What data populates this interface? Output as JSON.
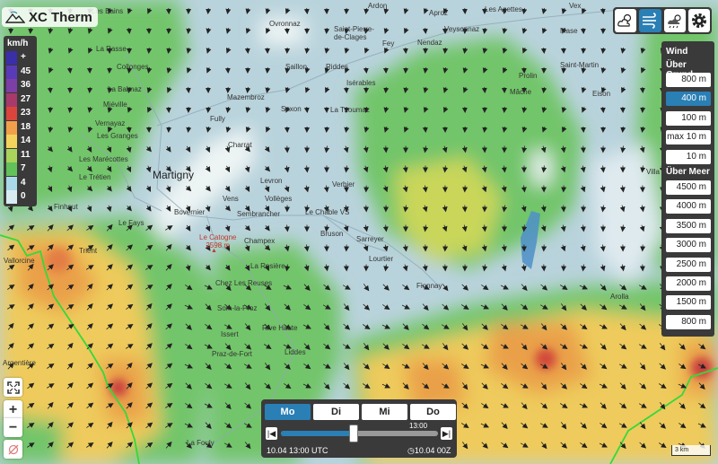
{
  "app": {
    "title": "XC Therm"
  },
  "legend": {
    "unit": "km/h",
    "rows": [
      {
        "label": "+",
        "color": "#3a2fa8"
      },
      {
        "label": "45",
        "color": "#5a3bb7"
      },
      {
        "label": "36",
        "color": "#7b3fa6"
      },
      {
        "label": "27",
        "color": "#a73a6b"
      },
      {
        "label": "23",
        "color": "#d9453c"
      },
      {
        "label": "18",
        "color": "#f0a04a"
      },
      {
        "label": "14",
        "color": "#f3d25e"
      },
      {
        "label": "11",
        "color": "#a9d35a"
      },
      {
        "label": "7",
        "color": "#63c15a"
      },
      {
        "label": "4",
        "color": "#a9d9e8"
      },
      {
        "label": "0",
        "color": "#d8ecf2"
      }
    ]
  },
  "top_buttons": [
    {
      "icon": "cloud-sun-icon",
      "active": false
    },
    {
      "icon": "wind-icon",
      "active": true
    },
    {
      "icon": "weather-overview-icon",
      "active": false
    },
    {
      "icon": "gear-icon",
      "active": false
    }
  ],
  "panel": {
    "title": "Wind",
    "section_ground": "Über Grund",
    "ground_levels": [
      "800 m",
      "400 m",
      "100 m",
      "max 10 m",
      "10 m"
    ],
    "ground_active": "400 m",
    "section_sea": "Über Meer",
    "sea_levels": [
      "4500 m",
      "4000 m",
      "3500 m",
      "3000 m",
      "2500 m",
      "2000 m",
      "1500 m",
      "800 m"
    ]
  },
  "timebar": {
    "days": [
      "Mo",
      "Di",
      "Mi",
      "Do"
    ],
    "active_day": "Mo",
    "start_label": "10.04 13:00 UTC",
    "end_label": "10.04 00Z",
    "tooltip": "13:00",
    "step_back": "|◀",
    "step_forward": "▶|",
    "progress": 0.46
  },
  "zoom": {
    "fullscreen_icon": "fullscreen-icon",
    "zoom_in": "+",
    "zoom_out": "−",
    "locate_icon": "location-off-icon"
  },
  "scale_label": "3 km",
  "map_labels": [
    {
      "text": "Les Bains",
      "cls": ""
    },
    {
      "text": "Ovronnaz",
      "cls": ""
    },
    {
      "text": "Ardon",
      "cls": ""
    },
    {
      "text": "Aproz",
      "cls": ""
    },
    {
      "text": "Les Agettes",
      "cls": ""
    },
    {
      "text": "Vex",
      "cls": ""
    },
    {
      "text": "Saint-Pierre-\nde-Clages",
      "cls": ""
    },
    {
      "text": "Veysonnaz",
      "cls": ""
    },
    {
      "text": "Mase",
      "cls": ""
    },
    {
      "text": "Fey",
      "cls": ""
    },
    {
      "text": "Nendaz",
      "cls": ""
    },
    {
      "text": "La Rasse",
      "cls": ""
    },
    {
      "text": "Collonges",
      "cls": ""
    },
    {
      "text": "Saillon",
      "cls": ""
    },
    {
      "text": "Riddes",
      "cls": ""
    },
    {
      "text": "Isérables",
      "cls": ""
    },
    {
      "text": "Prolin",
      "cls": ""
    },
    {
      "text": "Saint-Martin",
      "cls": ""
    },
    {
      "text": "La Balmaz",
      "cls": ""
    },
    {
      "text": "Mazembroz",
      "cls": ""
    },
    {
      "text": "Mâche",
      "cls": ""
    },
    {
      "text": "Eison",
      "cls": ""
    },
    {
      "text": "Miéville",
      "cls": ""
    },
    {
      "text": "Saxon",
      "cls": ""
    },
    {
      "text": "La Tzoumaz",
      "cls": ""
    },
    {
      "text": "Vernayaz",
      "cls": ""
    },
    {
      "text": "Fully",
      "cls": ""
    },
    {
      "text": "Les Granges",
      "cls": ""
    },
    {
      "text": "Charrat",
      "cls": ""
    },
    {
      "text": "Les Marécottes",
      "cls": ""
    },
    {
      "text": "Le Trétien",
      "cls": ""
    },
    {
      "text": "Martigny",
      "cls": "big"
    },
    {
      "text": "Levron",
      "cls": ""
    },
    {
      "text": "Verbier",
      "cls": ""
    },
    {
      "text": "Villa",
      "cls": ""
    },
    {
      "text": "Finhaut",
      "cls": ""
    },
    {
      "text": "Vens",
      "cls": ""
    },
    {
      "text": "Vollèges",
      "cls": ""
    },
    {
      "text": "Bovernier",
      "cls": ""
    },
    {
      "text": "Sembrancher",
      "cls": ""
    },
    {
      "text": "Le Châble VS",
      "cls": ""
    },
    {
      "text": "Le Fays",
      "cls": ""
    },
    {
      "text": "Le Catogne\n2598 m",
      "cls": "peak"
    },
    {
      "text": "Bruson",
      "cls": ""
    },
    {
      "text": "Trient",
      "cls": ""
    },
    {
      "text": "Champex",
      "cls": ""
    },
    {
      "text": "Sarreyer",
      "cls": ""
    },
    {
      "text": "Lourtier",
      "cls": ""
    },
    {
      "text": "Vallorcine",
      "cls": ""
    },
    {
      "text": "La Rosière",
      "cls": ""
    },
    {
      "text": "Fionnay",
      "cls": ""
    },
    {
      "text": "Chez Les Reuses",
      "cls": ""
    },
    {
      "text": "Arolla",
      "cls": ""
    },
    {
      "text": "Som-la-Proz",
      "cls": ""
    },
    {
      "text": "Rive Haute",
      "cls": ""
    },
    {
      "text": "Issert",
      "cls": ""
    },
    {
      "text": "Liddes",
      "cls": ""
    },
    {
      "text": "Praz-de-Fort",
      "cls": ""
    },
    {
      "text": "Argentière",
      "cls": ""
    },
    {
      "text": "La Fouly",
      "cls": ""
    }
  ]
}
